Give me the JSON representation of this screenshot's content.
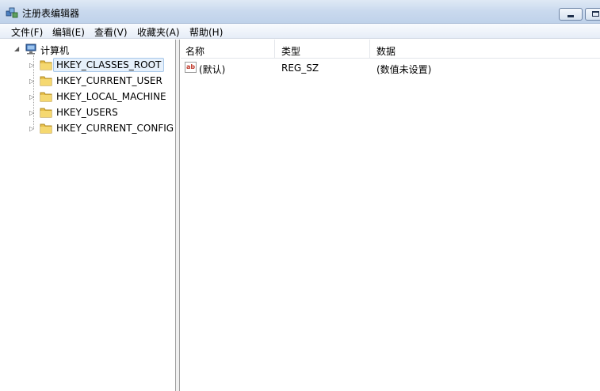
{
  "window": {
    "title": "注册表编辑器"
  },
  "menu": [
    "文件(F)",
    "编辑(E)",
    "查看(V)",
    "收藏夹(A)",
    "帮助(H)"
  ],
  "tree": {
    "root": "计算机",
    "items": [
      {
        "label": "HKEY_CLASSES_ROOT",
        "selected": true
      },
      {
        "label": "HKEY_CURRENT_USER"
      },
      {
        "label": "HKEY_LOCAL_MACHINE"
      },
      {
        "label": "HKEY_USERS"
      },
      {
        "label": "HKEY_CURRENT_CONFIG"
      }
    ]
  },
  "list": {
    "columns": [
      "名称",
      "类型",
      "数据"
    ],
    "rows": [
      {
        "name": "(默认)",
        "type": "REG_SZ",
        "data": "(数值未设置)",
        "icon": "string-value-icon"
      }
    ]
  },
  "colors": {
    "titlebar": "#c9d9ee",
    "selection": "#e6f0fb",
    "folder": "#e8c04a"
  }
}
